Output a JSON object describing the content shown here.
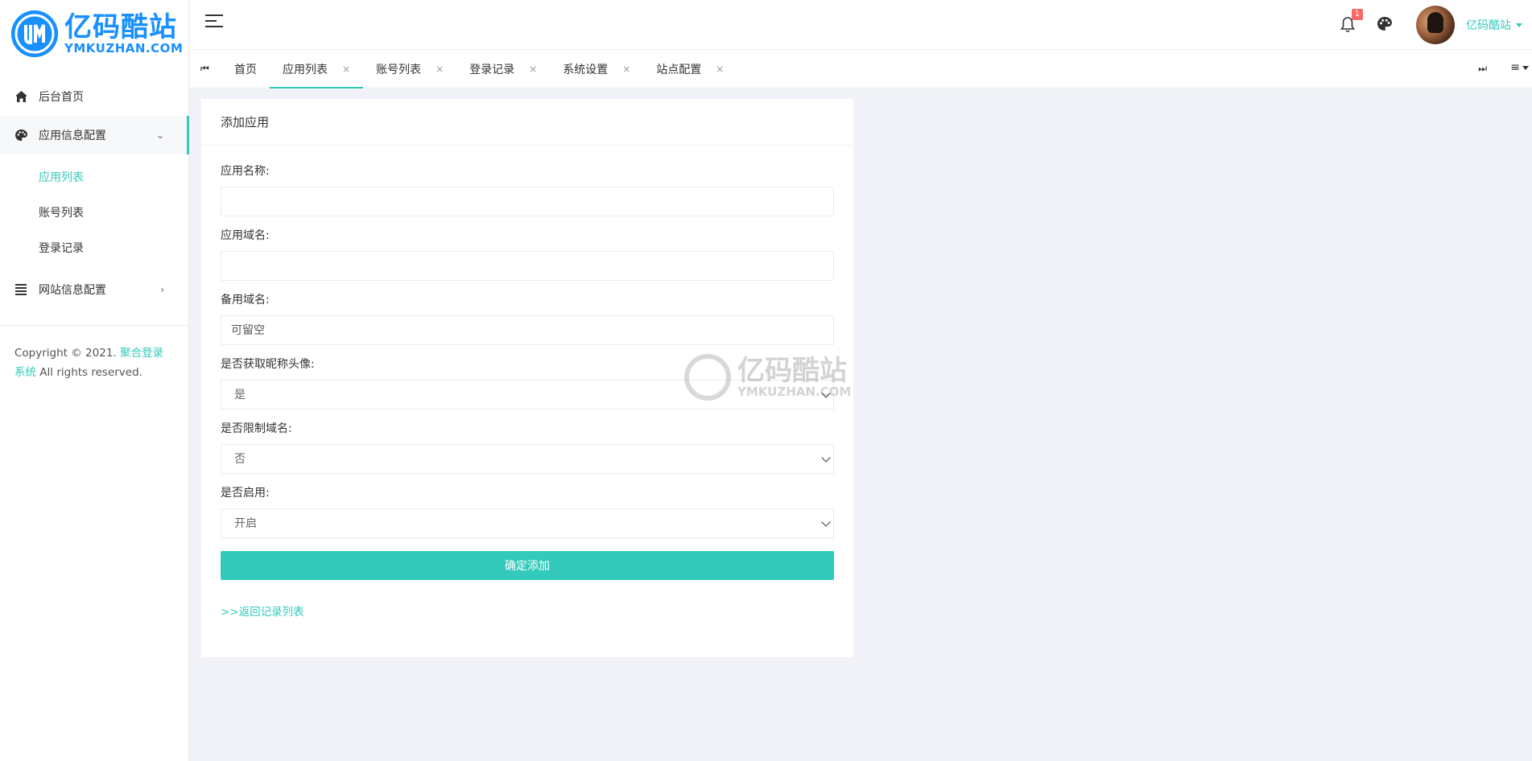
{
  "brand": {
    "name_cn": "亿码酷站",
    "name_en": "YMKUZHAN.COM"
  },
  "sidebar": {
    "items": [
      {
        "label": "后台首页"
      },
      {
        "label": "应用信息配置",
        "children": [
          {
            "label": "应用列表"
          },
          {
            "label": "账号列表"
          },
          {
            "label": "登录记录"
          }
        ]
      },
      {
        "label": "网站信息配置"
      }
    ],
    "copyright_prefix": "Copyright © 2021. ",
    "copyright_link": "聚合登录系统",
    "copyright_suffix": " All rights reserved."
  },
  "header": {
    "notification_count": "1",
    "username": "亿码酷站"
  },
  "tabs": [
    {
      "label": "首页"
    },
    {
      "label": "应用列表"
    },
    {
      "label": "账号列表"
    },
    {
      "label": "登录记录"
    },
    {
      "label": "系统设置"
    },
    {
      "label": "站点配置"
    }
  ],
  "tab_icons": {
    "prev": "⏮",
    "next": "⏭",
    "menu": "≡",
    "close": "×"
  },
  "form": {
    "title": "添加应用",
    "fields": {
      "app_name": {
        "label": "应用名称:",
        "value": "",
        "placeholder": ""
      },
      "app_domain": {
        "label": "应用域名:",
        "value": "",
        "placeholder": ""
      },
      "backup_domain": {
        "label": "备用域名:",
        "value": "",
        "placeholder": "可留空"
      },
      "fetch_avatar": {
        "label": "是否获取昵称头像:",
        "selected": "是"
      },
      "limit_domain": {
        "label": "是否限制域名:",
        "selected": "否"
      },
      "enabled": {
        "label": "是否启用:",
        "selected": "开启"
      }
    },
    "submit_label": "确定添加",
    "back_link": ">>返回记录列表"
  },
  "colors": {
    "accent": "#33cabb",
    "brand": "#1890ff",
    "badge": "#f96868",
    "bg": "#f2f3f8"
  }
}
